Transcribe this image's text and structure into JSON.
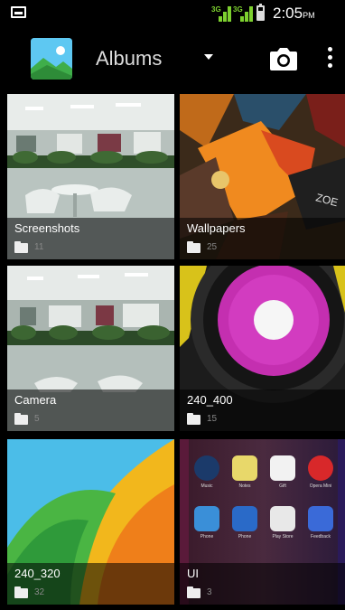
{
  "status_bar": {
    "network_1": "3G",
    "network_2": "3G",
    "time": "2:05",
    "ampm": "PM"
  },
  "action_bar": {
    "title": "Albums",
    "icons": [
      "gallery-app-icon",
      "dropdown-icon",
      "camera-icon",
      "overflow-menu-icon"
    ]
  },
  "albums": [
    {
      "name": "Screenshots",
      "count": "11"
    },
    {
      "name": "Wallpapers",
      "count": "25"
    },
    {
      "name": "Camera",
      "count": "5"
    },
    {
      "name": "240_400",
      "count": "15"
    },
    {
      "name": "240_320",
      "count": "32"
    },
    {
      "name": "UI",
      "count": "3"
    }
  ],
  "ui_thumb_apps": [
    "Music",
    "Notes",
    "Gift",
    "Opera Mini",
    "Phone",
    "Phone",
    "Play Store",
    "Feedback"
  ],
  "colors": {
    "background": "#000000",
    "signal": "#7dd12f",
    "caption_overlay": "rgba(0,0,0,0.55)"
  }
}
